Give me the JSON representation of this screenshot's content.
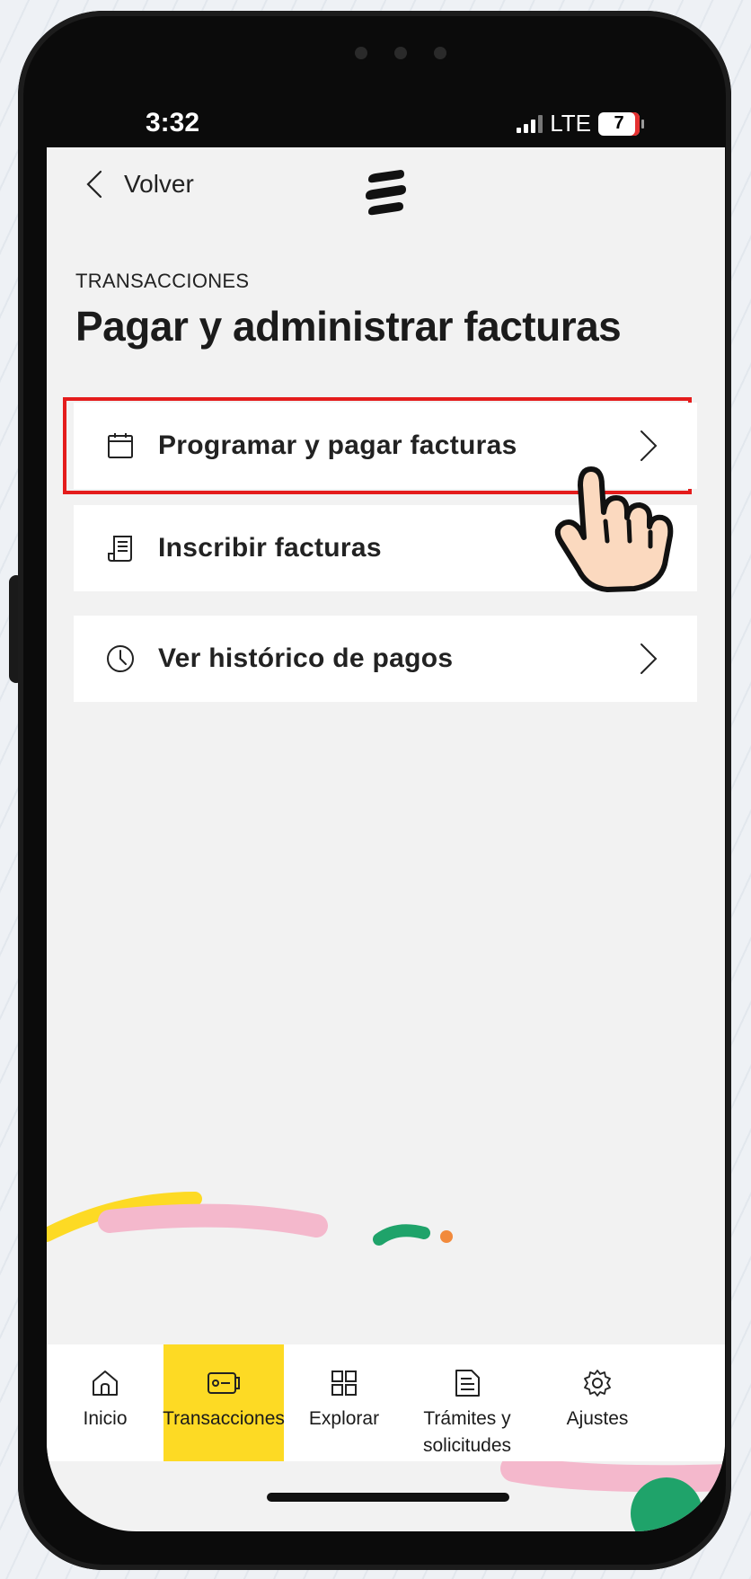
{
  "status_bar": {
    "time": "3:32",
    "network": "LTE",
    "battery_level": "7"
  },
  "header": {
    "back_label": "Volver",
    "logo_icon": "bancolombia-logo-icon"
  },
  "page": {
    "section": "TRANSACCIONES",
    "title": "Pagar y administrar facturas"
  },
  "menu": {
    "items": [
      {
        "label": "Programar y pagar facturas",
        "icon": "calendar-icon",
        "highlighted": true
      },
      {
        "label": "Inscribir facturas",
        "icon": "receipt-icon"
      },
      {
        "label": "Ver histórico de pagos",
        "icon": "clock-icon"
      }
    ]
  },
  "bottom_nav": {
    "active": "Transacciones",
    "items": [
      {
        "label": "Inicio",
        "icon": "home-icon"
      },
      {
        "label": "Transacciones",
        "icon": "card-transfer-icon"
      },
      {
        "label": "Explorar",
        "icon": "grid-icon"
      },
      {
        "label": "Trámites y solicitudes",
        "icon": "document-icon"
      },
      {
        "label": "Ajustes",
        "icon": "gear-icon"
      }
    ]
  },
  "colors": {
    "accent_yellow": "#fdda24",
    "highlight_red": "#e41c1c",
    "screen_bg": "#f2f2f2"
  }
}
